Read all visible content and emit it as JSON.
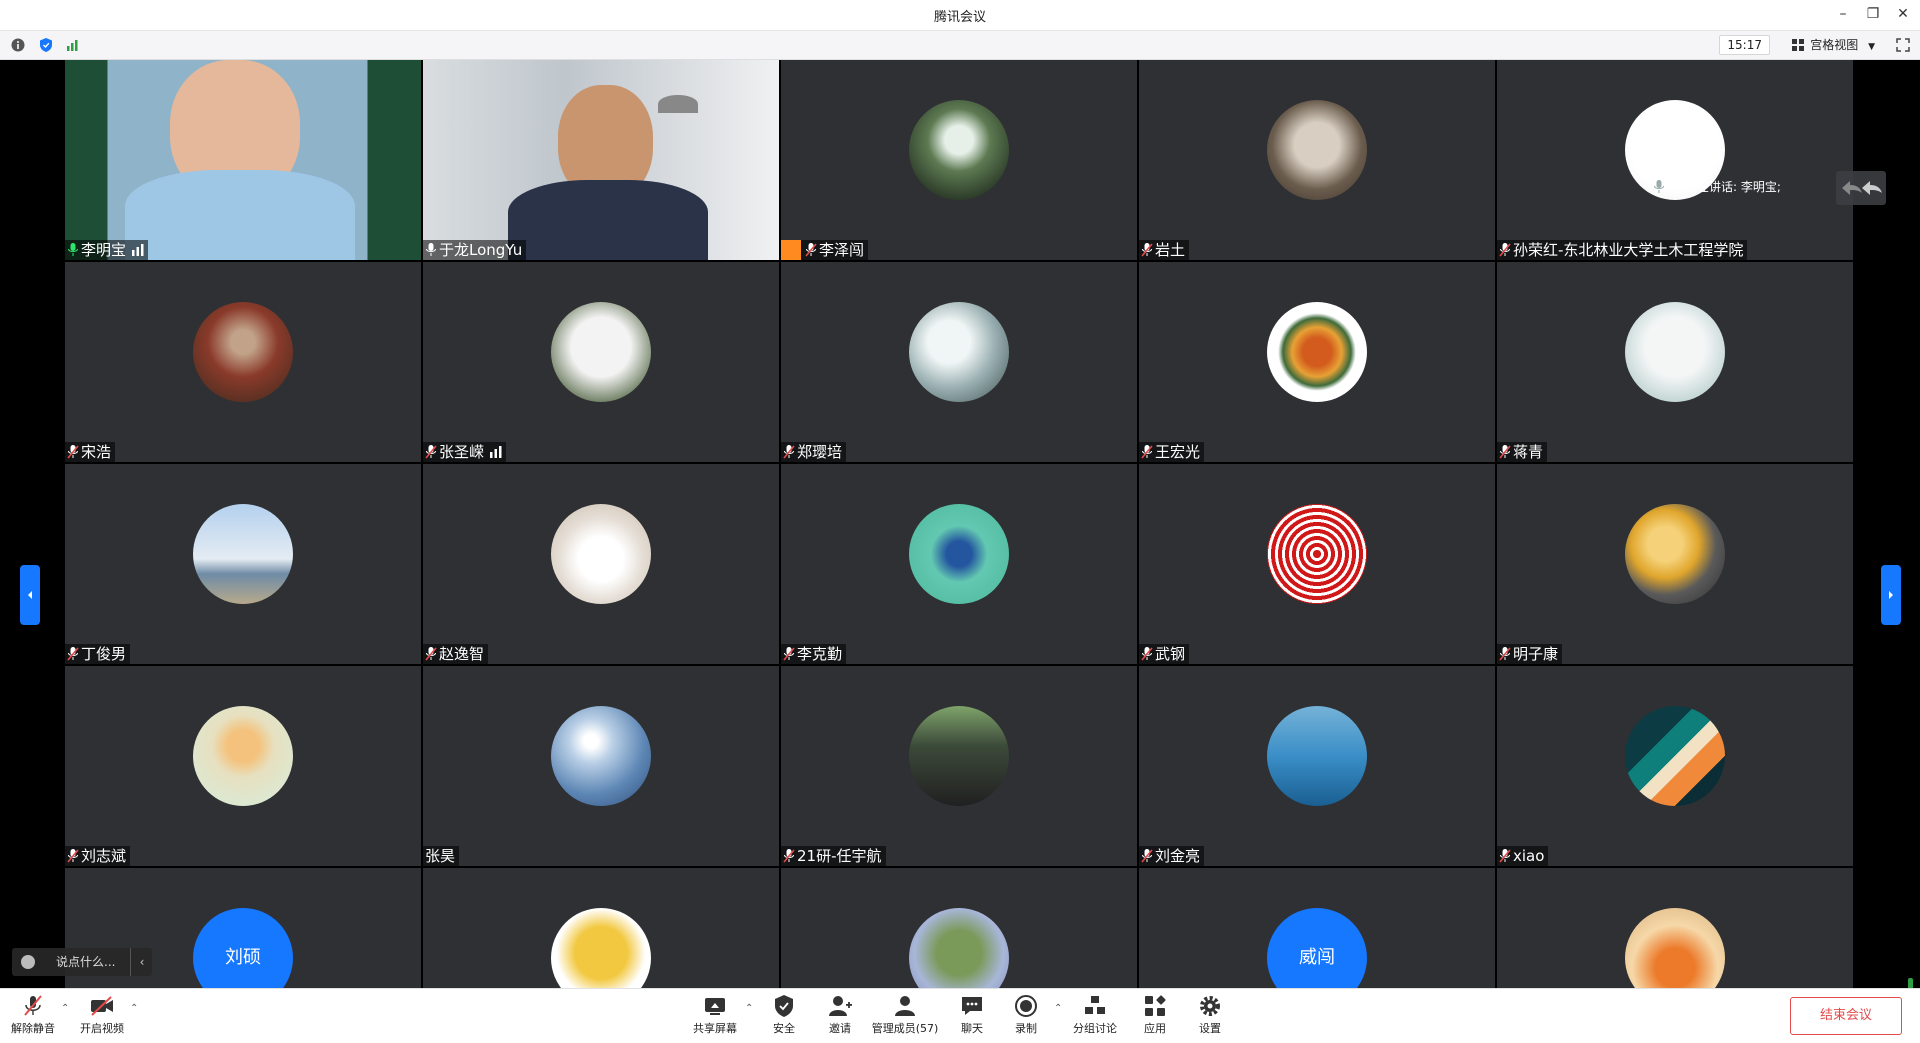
{
  "window": {
    "title": "腾讯会议"
  },
  "toolbar_top": {
    "time": "15:17",
    "view_label": "宫格视图"
  },
  "speaking": {
    "label": "正在讲话: 李明宝;"
  },
  "chat": {
    "placeholder": "说点什么..."
  },
  "colors": {
    "tile_bg": "#2e3033",
    "accent_blue": "#1677ff",
    "host_orange": "#ff8a1f",
    "end_red": "#e24b4b",
    "active_green": "#1ed760"
  },
  "participants": [
    {
      "name": "李明宝",
      "kind": "video",
      "mic": "on-green",
      "bars": true,
      "active": true
    },
    {
      "name": "于龙LongYu",
      "kind": "video",
      "mic": "on-white"
    },
    {
      "name": "李泽闯",
      "kind": "photo",
      "mic": "muted",
      "host": true
    },
    {
      "name": "岩土",
      "kind": "photo",
      "mic": "muted"
    },
    {
      "name": "孙荣红-东北林业大学土木工程学院",
      "kind": "photo",
      "mic": "muted"
    },
    {
      "name": "宋浩",
      "kind": "photo",
      "mic": "muted"
    },
    {
      "name": "张圣嵘",
      "kind": "photo",
      "mic": "muted",
      "bars": true
    },
    {
      "name": "郑璎培",
      "kind": "photo",
      "mic": "muted"
    },
    {
      "name": "王宏光",
      "kind": "photo",
      "mic": "muted"
    },
    {
      "name": "蒋青",
      "kind": "photo",
      "mic": "muted"
    },
    {
      "name": "丁俊男",
      "kind": "photo",
      "mic": "muted"
    },
    {
      "name": "赵逸智",
      "kind": "photo",
      "mic": "muted"
    },
    {
      "name": "李克勤",
      "kind": "photo",
      "mic": "muted"
    },
    {
      "name": "武钢",
      "kind": "photo",
      "mic": "muted"
    },
    {
      "name": "明子康",
      "kind": "photo",
      "mic": "muted"
    },
    {
      "name": "刘志斌",
      "kind": "photo",
      "mic": "muted"
    },
    {
      "name": "张昊",
      "kind": "photo",
      "mic": "none"
    },
    {
      "name": "21研-任宇航",
      "kind": "photo",
      "mic": "muted"
    },
    {
      "name": "刘金亮",
      "kind": "photo",
      "mic": "muted"
    },
    {
      "name": "xiao",
      "kind": "photo",
      "mic": "muted"
    },
    {
      "name": "",
      "kind": "initials",
      "initials": "刘硕"
    },
    {
      "name": "",
      "kind": "photo"
    },
    {
      "name": "",
      "kind": "photo"
    },
    {
      "name": "",
      "kind": "initials",
      "initials": "威闯"
    },
    {
      "name": "",
      "kind": "photo"
    }
  ],
  "bottom_bar": {
    "unmute": "解除静音",
    "start_video": "开启视频",
    "share_screen": "共享屏幕",
    "security": "安全",
    "invite": "邀请",
    "manage_members": "管理成员(57)",
    "chat": "聊天",
    "record": "录制",
    "breakout": "分组讨论",
    "apps": "应用",
    "settings": "设置",
    "end_meeting": "结束会议"
  }
}
